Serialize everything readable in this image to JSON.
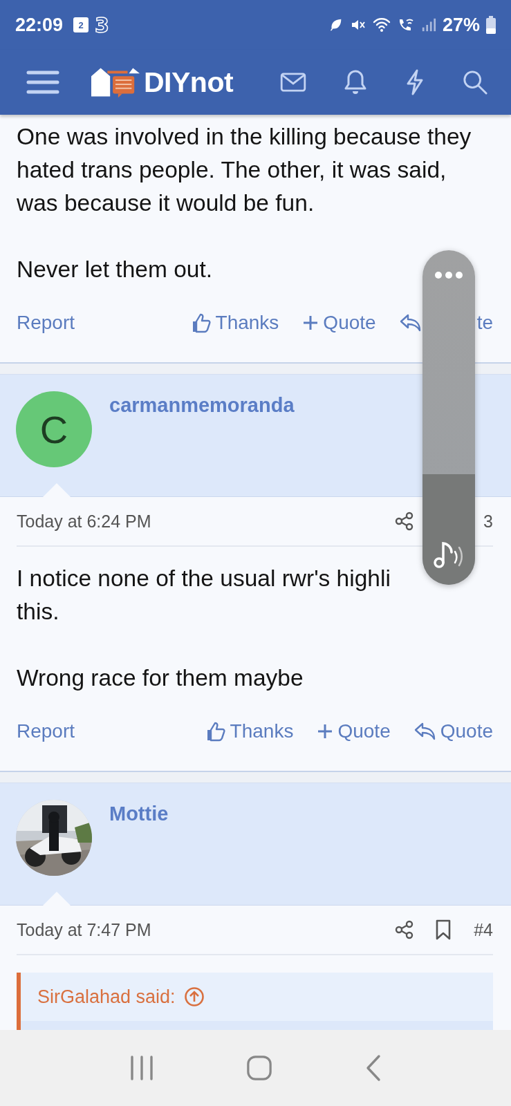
{
  "status_bar": {
    "time": "22:09",
    "calendar_badge": "2",
    "carrier": "3",
    "battery": "27%"
  },
  "header": {
    "logo": "DIYnot"
  },
  "posts": [
    {
      "kind": "continuation",
      "paragraphs": [
        [
          "One was involved in the killing because they",
          "hated trans people. The other, it was said,",
          "was because it would be fun."
        ],
        [
          "Never let them out."
        ]
      ],
      "report": "Report",
      "actions": [
        {
          "kind": "thanks",
          "label": "Thanks"
        },
        {
          "kind": "multiquote",
          "label": "Quote"
        },
        {
          "kind": "reply",
          "label": "te"
        }
      ]
    },
    {
      "kind": "full",
      "avatar": {
        "kind": "letter",
        "letter": "C"
      },
      "username": "carmanmemoranda",
      "date": "Today at 6:24 PM",
      "bookmark": false,
      "number": "3",
      "paragraphs": [
        [
          "I notice none of the usual rwr's highli",
          "this."
        ],
        [
          "Wrong race for them maybe"
        ]
      ],
      "report": "Report",
      "actions": [
        {
          "kind": "thanks",
          "label": "Thanks"
        },
        {
          "kind": "multiquote",
          "label": "Quote"
        },
        {
          "kind": "reply",
          "label": "Quote"
        }
      ]
    },
    {
      "kind": "full",
      "username": "Mottie",
      "date": "Today at 7:47 PM",
      "bookmark": true,
      "number": "#4",
      "quote": {
        "attribution": "SirGalahad said:"
      }
    }
  ],
  "volume_panel": {
    "level": 0.33
  }
}
